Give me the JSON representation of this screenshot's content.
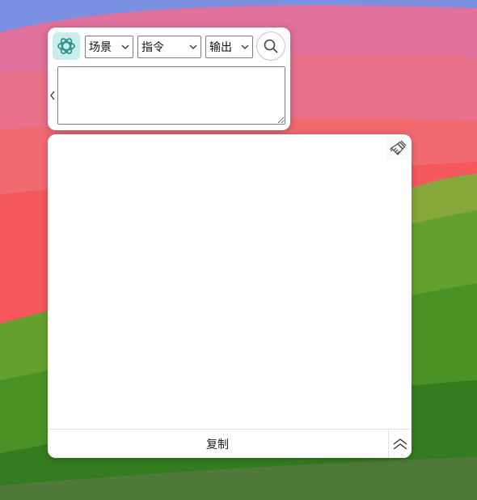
{
  "toolbar": {
    "scene_select": {
      "value": "场景"
    },
    "command_select": {
      "value": "指令"
    },
    "output_select": {
      "value": "输出"
    }
  },
  "prompt": {
    "value": "",
    "placeholder": ""
  },
  "output": {
    "text": ""
  },
  "footer": {
    "copy_label": "复制"
  },
  "icons": {
    "logo": "chatgpt-logo-icon",
    "search": "search-icon",
    "collapse": "chevron-left-icon",
    "clear": "broom-icon",
    "scroll_top": "double-chevron-up-icon"
  },
  "colors": {
    "logo_bg": "#c9ecec",
    "logo_stroke": "#2f8f8a",
    "panel_bg": "#ffffff",
    "wallpaper_top": "#7a8fe0",
    "wallpaper_red": "#f05a5f",
    "wallpaper_green": "#3f8f22"
  }
}
